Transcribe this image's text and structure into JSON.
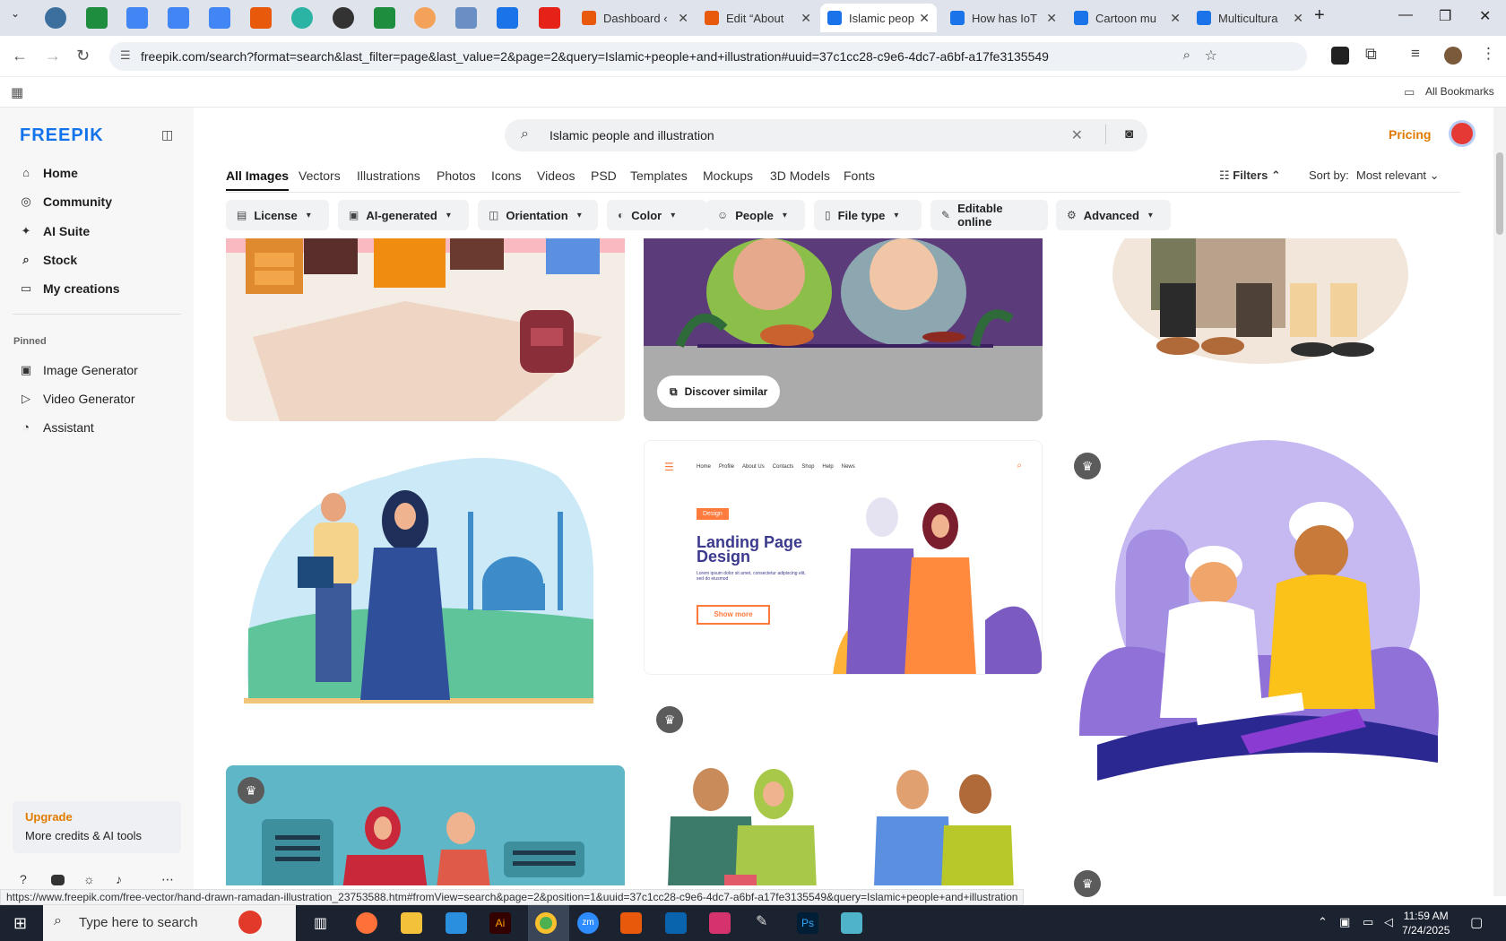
{
  "browser": {
    "tabs": [
      {
        "title": "Dashboard ‹",
        "color": "#e8590c"
      },
      {
        "title": "Edit “About",
        "color": "#e8590c"
      },
      {
        "title": "Islamic peop",
        "color": "#1a73e8",
        "active": true
      },
      {
        "title": "How has IoT",
        "color": "#1a73e8"
      },
      {
        "title": "Cartoon mu",
        "color": "#1a73e8"
      },
      {
        "title": "Multicultura",
        "color": "#1a73e8"
      }
    ],
    "url": "freepik.com/search?format=search&last_filter=page&last_value=2&page=2&query=Islamic+people+and+illustration#uuid=37c1cc28-c9e6-4dc7-a6bf-a17fe3135549",
    "bookmarks_label": "All Bookmarks"
  },
  "sidebar": {
    "logo": "FREEPIK",
    "items": [
      {
        "label": "Home",
        "icon": "home-icon",
        "glyph": "⌂"
      },
      {
        "label": "Community",
        "icon": "globe-icon",
        "glyph": "◎"
      },
      {
        "label": "AI Suite",
        "icon": "sparkle-icon",
        "glyph": "✦"
      },
      {
        "label": "Stock",
        "icon": "search-icon",
        "glyph": "⌕"
      },
      {
        "label": "My creations",
        "icon": "folder-icon",
        "glyph": "▭"
      }
    ],
    "pinned_heading": "Pinned",
    "pinned": [
      {
        "label": "Image Generator",
        "icon": "image-icon",
        "glyph": "▣"
      },
      {
        "label": "Video Generator",
        "icon": "video-icon",
        "glyph": "▷"
      },
      {
        "label": "Assistant",
        "icon": "chat-icon",
        "glyph": "◔"
      }
    ],
    "upgrade_title": "Upgrade",
    "upgrade_sub": "More credits & AI tools"
  },
  "header": {
    "search_value": "Islamic people and illustration",
    "pricing": "Pricing"
  },
  "type_tabs": [
    "All Images",
    "Vectors",
    "Illustrations",
    "Photos",
    "Icons",
    "Videos",
    "PSD",
    "Templates",
    "Mockups",
    "3D Models",
    "Fonts"
  ],
  "controls": {
    "filters": "Filters",
    "sort_label": "Sort by:",
    "sort_value": "Most relevant"
  },
  "filter_chips": [
    "License",
    "AI-generated",
    "Orientation",
    "Color",
    "People",
    "File type",
    "Editable online",
    "Advanced"
  ],
  "results": {
    "discover_similar": "Discover similar",
    "landing": {
      "nav": [
        "Home",
        "Profile",
        "About Us",
        "Contacts",
        "Shop",
        "Help",
        "News"
      ],
      "tag": "Design",
      "title_line1": "Landing Page",
      "title_line2": "Design",
      "body": "Lorem ipsum dolor sit amet, consectetur adipiscing elit, sed do eiusmod",
      "cta": "Show more"
    }
  },
  "status_url": "https://www.freepik.com/free-vector/hand-drawn-ramadan-illustration_23753588.htm#fromView=search&page=2&position=1&uuid=37c1cc28-c9e6-4dc7-a6bf-a17fe3135549&query=Islamic+people+and+illustration",
  "taskbar": {
    "search_placeholder": "Type here to search",
    "time": "11:59 AM",
    "date": "7/24/2025"
  }
}
